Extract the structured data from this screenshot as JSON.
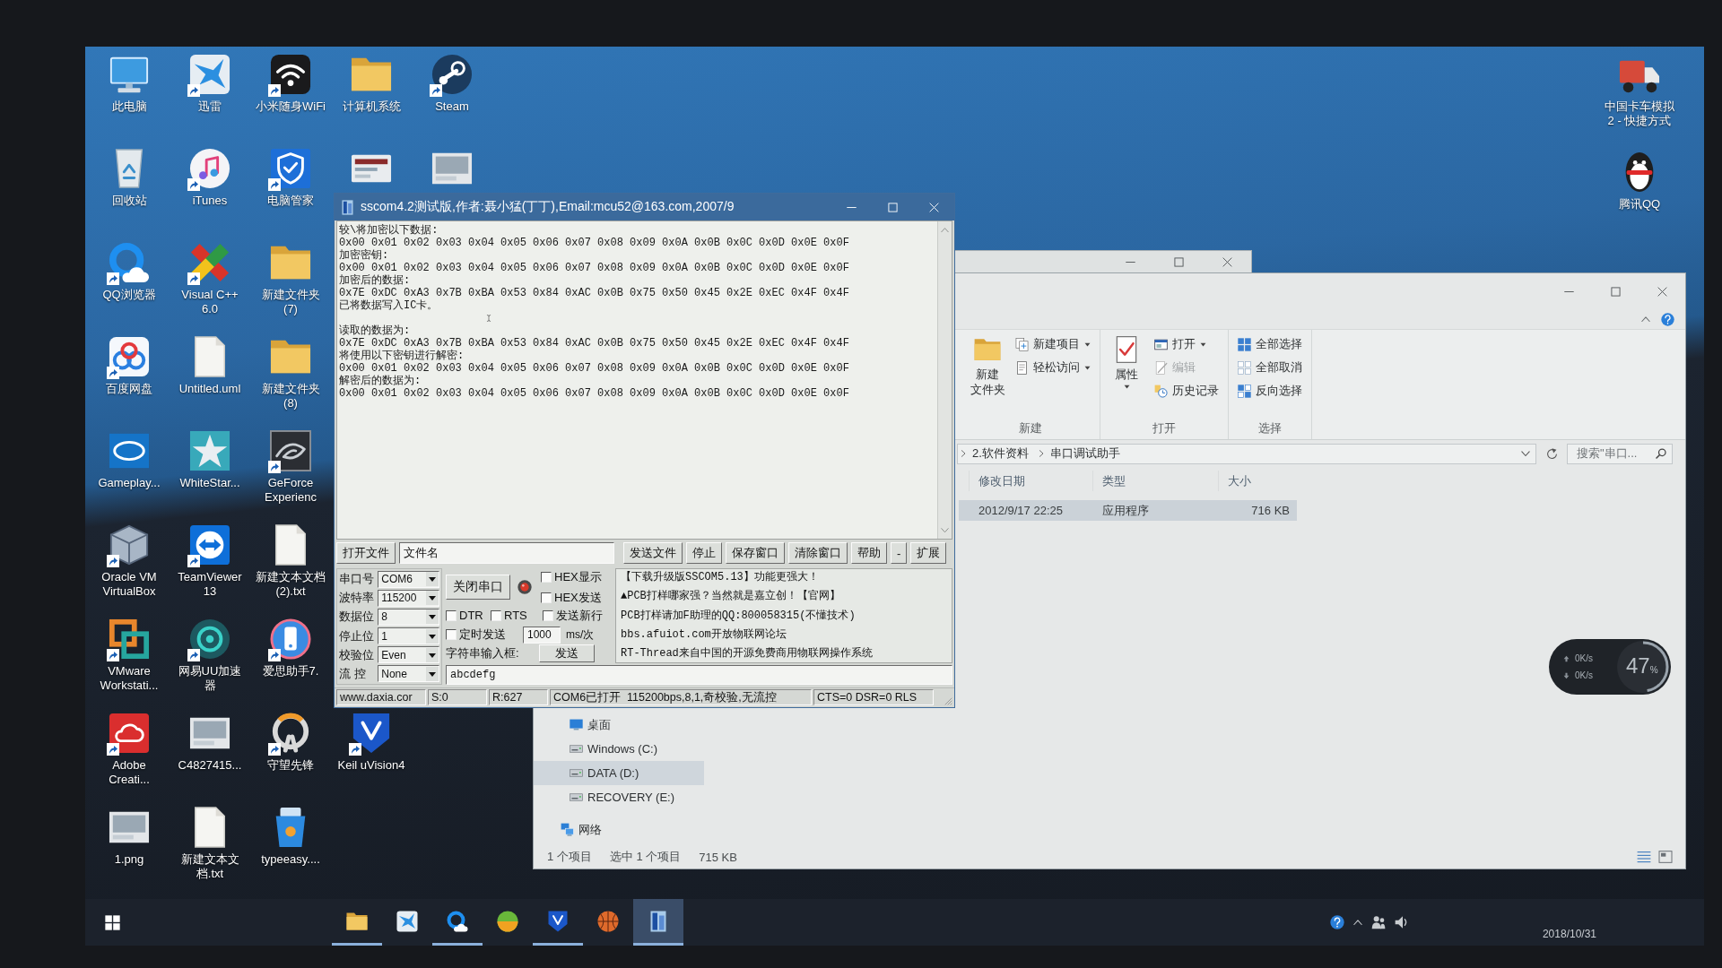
{
  "desktop": {
    "icons": [
      [
        {
          "label": "此电脑",
          "kind": "pc",
          "shortcut": false
        },
        {
          "label": "迅雷",
          "kind": "bird",
          "shortcut": true
        },
        {
          "label": "小米随身WiFi",
          "kind": "wifi",
          "shortcut": true
        },
        {
          "label": "计算机系统",
          "kind": "folder",
          "shortcut": false
        },
        {
          "label": "Steam",
          "kind": "steam",
          "shortcut": true
        }
      ],
      [
        {
          "label": "回收站",
          "kind": "bin",
          "shortcut": false
        },
        {
          "label": "iTunes",
          "kind": "music",
          "shortcut": true
        },
        {
          "label": "电脑管家",
          "kind": "shield",
          "shortcut": true
        },
        {
          "kind": "card",
          "shortcut": false
        },
        {
          "kind": "photo",
          "shortcut": false
        }
      ],
      [
        {
          "label": "QQ浏览器",
          "kind": "ringcloud",
          "shortcut": true
        },
        {
          "label": "Visual C++ 6.0",
          "kind": "cross",
          "shortcut": true
        },
        {
          "label": "新建文件夹 (7)",
          "kind": "folder",
          "shortcut": false
        }
      ],
      [
        {
          "label": "百度网盘",
          "kind": "cloud",
          "shortcut": true
        },
        {
          "label": "Untitled.uml",
          "kind": "doc",
          "shortcut": false
        },
        {
          "label": "新建文件夹 (8)",
          "kind": "folder",
          "shortcut": false
        }
      ],
      [
        {
          "label": "Gameplay...",
          "kind": "chip",
          "shortcut": false
        },
        {
          "label": "WhiteStar...",
          "kind": "star",
          "shortcut": false
        },
        {
          "label": "GeForce Experienc",
          "kind": "eye",
          "shortcut": true
        }
      ],
      [
        {
          "label": "Oracle VM VirtualBox",
          "kind": "cube",
          "shortcut": true
        },
        {
          "label": "TeamViewer 13",
          "kind": "arrows",
          "shortcut": true
        },
        {
          "label": "新建文本文档 (2).txt",
          "kind": "doc",
          "shortcut": false
        }
      ],
      [
        {
          "label": "VMware Workstati...",
          "kind": "squares",
          "shortcut": true
        },
        {
          "label": "网易UU加速器",
          "kind": "target",
          "shortcut": true
        },
        {
          "label": "爱思助手7.",
          "kind": "phone",
          "shortcut": true
        }
      ],
      [
        {
          "label": "Adobe Creati...",
          "kind": "cloudline",
          "shortcut": true
        },
        {
          "label": "C4827415...",
          "kind": "photo",
          "shortcut": false
        },
        {
          "label": "守望先锋",
          "kind": "ring",
          "shortcut": true
        },
        {
          "label": "Keil uVision4",
          "kind": "shieldv",
          "shortcut": true
        }
      ],
      [
        {
          "label": "1.png",
          "kind": "photo",
          "shortcut": false
        },
        {
          "label": "新建文本文档.txt",
          "kind": "doc",
          "shortcut": false
        },
        {
          "label": "typeeasy....",
          "kind": "bag",
          "shortcut": false
        }
      ]
    ],
    "right_icons": [
      {
        "label": "中国卡车模拟 2 - 快捷方式",
        "kind": "truck",
        "shortcut": false
      },
      {
        "label": "腾讯QQ",
        "kind": "penguin",
        "shortcut": false
      }
    ]
  },
  "sscom": {
    "title": "sscom4.2测试版,作者:聂小猛(丁丁),Email:mcu52@163.com,2007/9",
    "receive_blocks": [
      [
        "较\\将加密以下数据:",
        "0x00 0x01 0x02 0x03 0x04 0x05 0x06 0x07 0x08 0x09 0x0A 0x0B 0x0C 0x0D 0x0E 0x0F",
        "加密密钥:",
        "0x00 0x01 0x02 0x03 0x04 0x05 0x06 0x07 0x08 0x09 0x0A 0x0B 0x0C 0x0D 0x0E 0x0F",
        "加密后的数据:",
        "0x7E 0xDC 0xA3 0x7B 0xBA 0x53 0x84 0xAC 0x0B 0x75 0x50 0x45 0x2E 0xEC 0x4F 0x4F",
        "已将数据写入IC卡。"
      ],
      [
        "读取的数据为:",
        "0x7E 0xDC 0xA3 0x7B 0xBA 0x53 0x84 0xAC 0x0B 0x75 0x50 0x45 0x2E 0xEC 0x4F 0x4F",
        "将使用以下密钥进行解密:",
        "0x00 0x01 0x02 0x03 0x04 0x05 0x06 0x07 0x08 0x09 0x0A 0x0B 0x0C 0x0D 0x0E 0x0F",
        "解密后的数据为:",
        "0x00 0x01 0x02 0x03 0x04 0x05 0x06 0x07 0x08 0x09 0x0A 0x0B 0x0C 0x0D 0x0E 0x0F"
      ]
    ],
    "toolbar": {
      "open_file": "打开文件",
      "filename": "文件名",
      "buttons": [
        "发送文件",
        "停止",
        "保存窗口",
        "清除窗口",
        "帮助",
        "-",
        "扩展"
      ]
    },
    "settings": [
      {
        "label": "串口号",
        "value": "COM6"
      },
      {
        "label": "波特率",
        "value": "115200"
      },
      {
        "label": "数据位",
        "value": "8"
      },
      {
        "label": "停止位",
        "value": "1"
      },
      {
        "label": "校验位",
        "value": "Even"
      },
      {
        "label": "流 控",
        "value": "None"
      }
    ],
    "port_button": "关闭串口",
    "port_open": true,
    "hex_display": {
      "label": "HEX显示",
      "checked": false
    },
    "hex_send": {
      "label": "HEX发送",
      "checked": false
    },
    "dtr": {
      "label": "DTR",
      "checked": false
    },
    "rts": {
      "label": "RTS",
      "checked": false
    },
    "send_newline": {
      "label": "发送新行",
      "checked": false
    },
    "timed_send": {
      "label": "定时发送",
      "checked": false
    },
    "interval": "1000",
    "interval_unit": "ms/次",
    "input_label": "字符串输入框:",
    "send_button": "发送",
    "input_value": "abcdefg",
    "ads": [
      "【下载升级版SSCOM5.13】功能更强大！",
      "▲PCB打样哪家强？当然就是嘉立创！【官网】",
      "PCB打样请加F助理的QQ:800058315(不懂技术)",
      "bbs.afuiot.com开放物联网论坛",
      "RT-Thread来自中国的开源免费商用物联网操作系统"
    ],
    "status": {
      "site": "www.daxia.cor",
      "sent": "S:0",
      "received": "R:627",
      "port_state": "COM6已打开  115200bps,8,1,奇校验,无流控",
      "lines": "CTS=0 DSR=0 RLS"
    }
  },
  "explorer": {
    "ribbon": {
      "groups": [
        {
          "label": "新建",
          "large": {
            "kind": "folder",
            "lines": [
              "新建",
              "文件夹"
            ],
            "dropdown": false
          },
          "items": [
            {
              "label": "新建项目",
              "kind": "newitem",
              "dropdown": true,
              "disabled": false
            },
            {
              "label": "轻松访问",
              "kind": "page",
              "dropdown": true,
              "disabled": false
            }
          ]
        },
        {
          "label": "打开",
          "large": {
            "kind": "check",
            "lines": [
              "属性"
            ],
            "dropdown": true
          },
          "items": [
            {
              "label": "打开",
              "kind": "window",
              "dropdown": true,
              "disabled": false
            },
            {
              "label": "编辑",
              "kind": "edit",
              "dropdown": false,
              "disabled": true
            },
            {
              "label": "历史记录",
              "kind": "history",
              "dropdown": false,
              "disabled": false
            }
          ]
        },
        {
          "label": "选择",
          "items": [
            {
              "label": "全部选择",
              "kind": "grid",
              "dropdown": false,
              "disabled": false
            },
            {
              "label": "全部取消",
              "kind": "gridoff",
              "dropdown": false,
              "disabled": false
            },
            {
              "label": "反向选择",
              "kind": "checker",
              "dropdown": false,
              "disabled": false
            }
          ]
        }
      ]
    },
    "address": {
      "path": [
        "2.软件资料",
        "串口调试助手"
      ],
      "search_placeholder": "搜索\"串口..."
    },
    "columns": [
      "修改日期",
      "类型",
      "大小"
    ],
    "rows": [
      {
        "cells": [
          "2012/9/17 22:25",
          "应用程序",
          "716 KB"
        ],
        "selected": true
      }
    ],
    "nav": [
      {
        "children": [
          {
            "label": "桌面",
            "kind": "screen",
            "selected": false
          },
          {
            "label": "Windows (C:)",
            "kind": "drive",
            "selected": false
          },
          {
            "label": "DATA (D:)",
            "kind": "drive",
            "selected": true
          },
          {
            "label": "RECOVERY (E:)",
            "kind": "drive",
            "selected": false
          }
        ]
      },
      {
        "label": "网络",
        "kind": "network",
        "selected": false
      }
    ],
    "status": {
      "item_count": "1 个项目",
      "selection": "选中 1 个项目",
      "selection_size": "715 KB"
    }
  },
  "net_widget": {
    "upload": "0K/s",
    "download": "0K/s",
    "usage": "47$_{%}$",
    "level": 0.47
  },
  "taskbar": {
    "apps": [
      {
        "kind": "folder",
        "running": true,
        "selected": false
      },
      {
        "kind": "bird",
        "running": false,
        "selected": false
      },
      {
        "kind": "ringcloud",
        "running": true,
        "selected": false
      },
      {
        "kind": "ball",
        "running": false,
        "selected": false
      },
      {
        "kind": "shieldv",
        "running": true,
        "selected": false
      },
      {
        "kind": "basketball",
        "running": false,
        "selected": false
      },
      {
        "kind": "serial",
        "running": true,
        "selected": true
      }
    ],
    "date": "2018/10/31"
  }
}
